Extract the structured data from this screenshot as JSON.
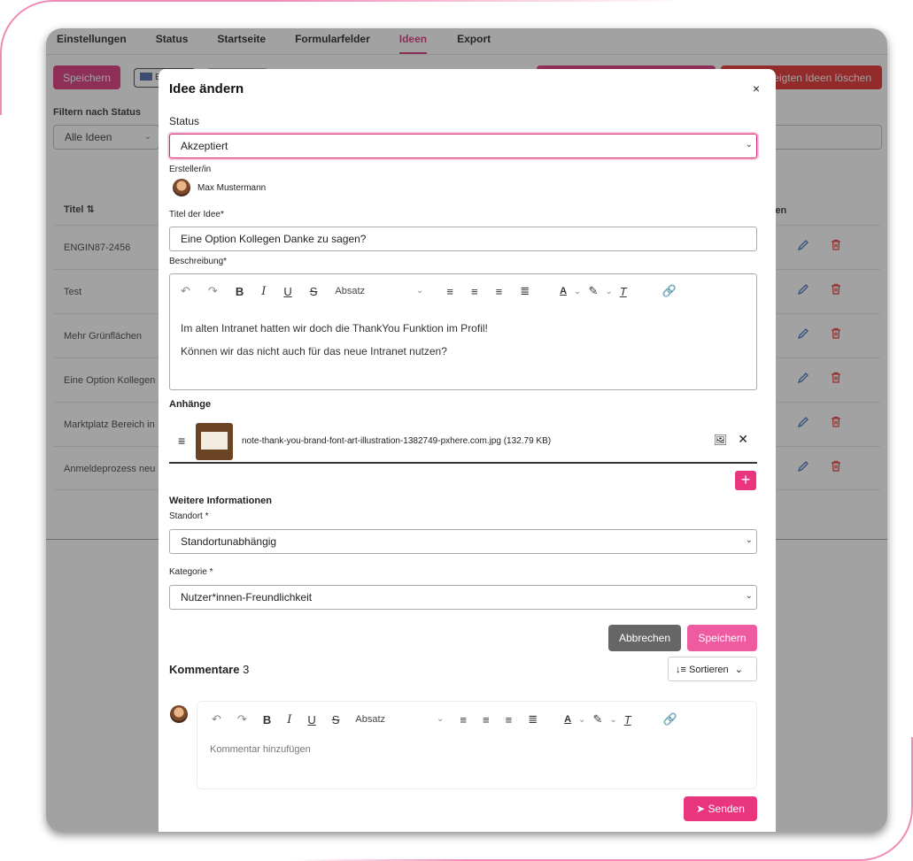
{
  "tabs": [
    "Einstellungen",
    "Status",
    "Startseite",
    "Formularfelder",
    "Ideen",
    "Export"
  ],
  "active_tab": "Ideen",
  "toolbar": {
    "save_label": "Speichern",
    "language_label": "E",
    "delete_shown_label": "eigten Ideen löschen"
  },
  "filter": {
    "label": "Filtern nach Status",
    "value": "Alle Ideen"
  },
  "table": {
    "title_header": "Titel ⇅",
    "actions_header": "onen",
    "rows": [
      "ENGIN87-2456",
      "Test",
      "Mehr Grünflächen",
      "Eine Option Kollegen",
      "Marktplatz Bereich in",
      "Anmeldeprozess neu"
    ]
  },
  "modal": {
    "title": "Idee ändern",
    "close": "×",
    "status_label": "Status",
    "status_value": "Akzeptiert",
    "author_label": "Ersteller/in",
    "author_name": "Max Mustermann",
    "idea_title_label": "Titel der Idee*",
    "idea_title_value": "Eine Option Kollegen Danke zu sagen?",
    "description_label": "Beschreibung*",
    "editor_paragraph_style": "Absatz",
    "description_lines": [
      "Im alten Intranet hatten wir doch die ThankYou Funktion im Profil!",
      "Können wir das nicht auch für das neue Intranet nutzen?"
    ],
    "attachments_label": "Anhänge",
    "attachment_filename": "note-thank-you-brand-font-art-illustration-1382749-pxhere.com.jpg (132.79 KB)",
    "more_info_label": "Weitere Informationen",
    "location_label": "Standort *",
    "location_value": "Standortunabhängig",
    "category_label": "Kategorie *",
    "category_value": "Nutzer*innen-Freundlichkeit",
    "cancel_label": "Abbrechen",
    "save_label": "Speichern",
    "comments_label": "Kommentare",
    "comments_count": "3",
    "sort_label": "Sortieren",
    "comment_placeholder": "Kommentar hinzufügen",
    "send_label": "Senden"
  },
  "colors": {
    "accent": "#d8246f",
    "danger": "#e21b1b",
    "overlay": "#3c3c3c"
  }
}
